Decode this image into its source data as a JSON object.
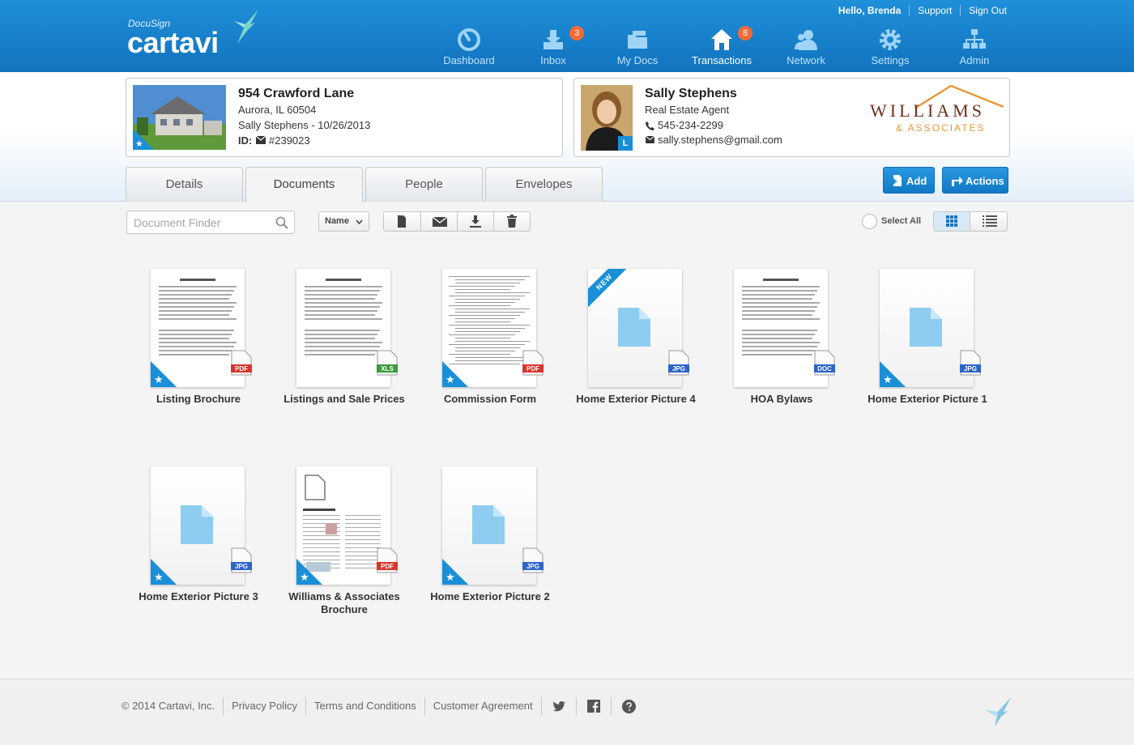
{
  "brand": {
    "small": "DocuSign",
    "name": "cartavi"
  },
  "user_links": {
    "greeting": "Hello, Brenda",
    "support": "Support",
    "signout": "Sign Out"
  },
  "nav": [
    {
      "label": "Dashboard",
      "icon": "dashboard-icon",
      "badge": ""
    },
    {
      "label": "Inbox",
      "icon": "inbox-icon",
      "badge": "3"
    },
    {
      "label": "My Docs",
      "icon": "my-docs-icon",
      "badge": ""
    },
    {
      "label": "Transactions",
      "icon": "home-icon",
      "badge": "8"
    },
    {
      "label": "Network",
      "icon": "network-icon",
      "badge": ""
    },
    {
      "label": "Settings",
      "icon": "gear-icon",
      "badge": ""
    },
    {
      "label": "Admin",
      "icon": "org-chart-icon",
      "badge": ""
    }
  ],
  "property": {
    "address": "954 Crawford Lane",
    "city": "Aurora, IL 60504",
    "owner_date": "Sally Stephens - 10/26/2013",
    "id_label": "ID:",
    "id_value": "#239023"
  },
  "agent": {
    "name": "Sally Stephens",
    "title": "Real Estate Agent",
    "phone": "545-234-2299",
    "email": "sally.stephens@gmail.com",
    "badge": "L",
    "company_main": "WILLIAMS",
    "company_sub": "& ASSOCIATES"
  },
  "tabs": [
    "Details",
    "Documents",
    "People",
    "Envelopes"
  ],
  "active_tab": "Documents",
  "header_buttons": {
    "add": "Add",
    "actions": "Actions"
  },
  "toolbar": {
    "search_placeholder": "Document Finder",
    "sort_label": "Name",
    "select_all": "Select All"
  },
  "documents": [
    {
      "name": "Listing Brochure",
      "type": "PDF",
      "type_color": "#d9342b",
      "thumb": "text",
      "starred": true,
      "new": false
    },
    {
      "name": "Listings and Sale Prices",
      "type": "XLS",
      "type_color": "#3a9b3a",
      "thumb": "text",
      "starred": false,
      "new": false
    },
    {
      "name": "Commission Form",
      "type": "PDF",
      "type_color": "#d9342b",
      "thumb": "form",
      "starred": true,
      "new": false
    },
    {
      "name": "Home Exterior Picture 4",
      "type": "JPG",
      "type_color": "#2d64c9",
      "thumb": "blank",
      "starred": false,
      "new": true,
      "new_label": "NEW"
    },
    {
      "name": "HOA Bylaws",
      "type": "DOC",
      "type_color": "#2d64c9",
      "thumb": "text",
      "starred": false,
      "new": false
    },
    {
      "name": "Home Exterior Picture 1",
      "type": "JPG",
      "type_color": "#2d64c9",
      "thumb": "blank",
      "starred": true,
      "new": false
    },
    {
      "name": "Home Exterior Picture 3",
      "type": "JPG",
      "type_color": "#2d64c9",
      "thumb": "blank",
      "starred": true,
      "new": false
    },
    {
      "name": "Williams & Associates Brochure",
      "type": "PDF",
      "type_color": "#d9342b",
      "thumb": "brochure",
      "starred": true,
      "new": false
    },
    {
      "name": "Home Exterior Picture 2",
      "type": "JPG",
      "type_color": "#2d64c9",
      "thumb": "blank",
      "starred": true,
      "new": false
    }
  ],
  "footer": {
    "copyright": "© 2014 Cartavi, Inc.",
    "privacy": "Privacy Policy",
    "terms": "Terms and Conditions",
    "agreement": "Customer Agreement"
  },
  "colors": {
    "header_blue": "#1a8fd8",
    "badge_orange": "#f16a36",
    "brand_brown": "#6b2f1e",
    "brand_orange": "#e59a3b"
  }
}
